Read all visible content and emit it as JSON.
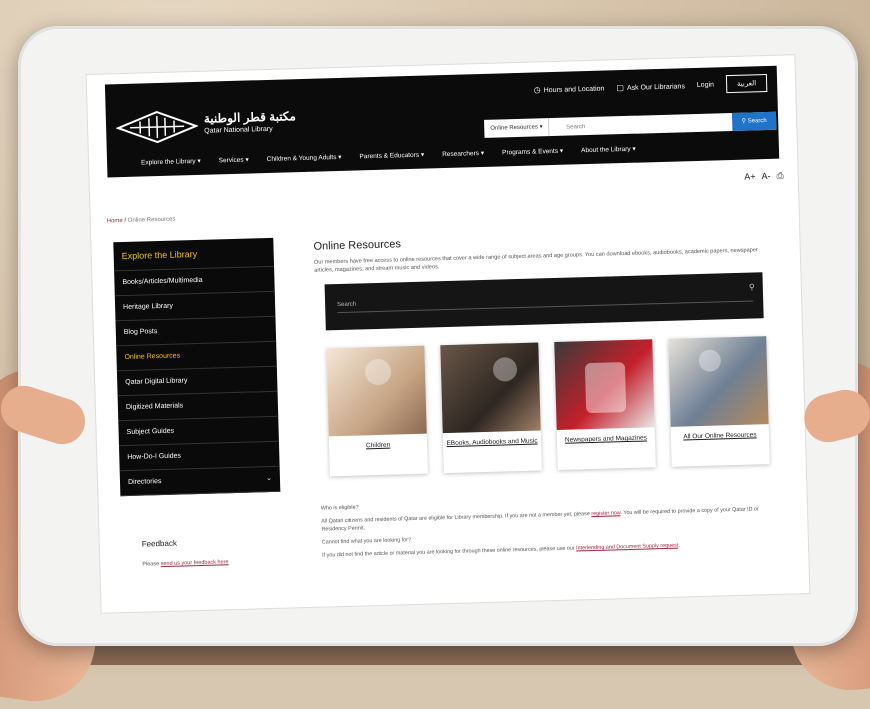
{
  "header": {
    "logo_arabic": "مكتبة قطر الوطنية",
    "logo_english": "Qatar National Library",
    "top_links": [
      {
        "icon": "clock-icon",
        "label": "Hours and Location"
      },
      {
        "icon": "chat-icon",
        "label": "Ask Our Librarians"
      },
      {
        "icon": "",
        "label": "Login"
      }
    ],
    "language_button": "العربية",
    "search": {
      "scope_label": "Online Resources",
      "placeholder": "Search",
      "button_label": "Search"
    },
    "nav": [
      "Explore the Library",
      "Services",
      "Children & Young Adults",
      "Parents & Educators",
      "Researchers",
      "Programs & Events",
      "About the Library"
    ]
  },
  "tools": {
    "font_up": "A+",
    "font_down": "A-",
    "print_icon": "printer-icon"
  },
  "breadcrumb": {
    "home": "Home",
    "separator": "/",
    "current": "Online Resources"
  },
  "sidebar": {
    "heading": "Explore the Library",
    "items": [
      "Books/Articles/Multimedia",
      "Heritage Library",
      "Blog Posts",
      "Online Resources",
      "Qatar Digital Library",
      "Digitized Materials",
      "Subject Guides",
      "How-Do-I Guides",
      "Directories"
    ],
    "active_index": 3
  },
  "feedback": {
    "title": "Feedback",
    "text_prefix": "Please ",
    "link": "send us your feedback here"
  },
  "main": {
    "title": "Online Resources",
    "description": "Our members have free access to online resources that cover a wide range of subject areas and age groups. You can download ebooks, audiobooks, academic papers, newspaper articles, magazines, and stream music and videos.",
    "search_placeholder": "Search",
    "cards": [
      {
        "label": "Children"
      },
      {
        "label": "EBooks, Audiobooks and Music"
      },
      {
        "label": "Newspapers and Magazines"
      },
      {
        "label": "All Our Online Resources"
      }
    ],
    "info": {
      "q1": "Who is eligible?",
      "a1_prefix": "All Qatari citizens and residents of Qatar are eligible for Library membership. If you are not a member yet, please ",
      "a1_link": "register now",
      "a1_suffix": ". You will be required to provide a copy of your Qatar ID or Residency Permit.",
      "q2": "Cannot find what you are looking for?",
      "a2_prefix": "If you did not find the article or material you are looking for through these online resources, please use our ",
      "a2_link": "Interlending and Document Supply request",
      "a2_suffix": "."
    }
  }
}
